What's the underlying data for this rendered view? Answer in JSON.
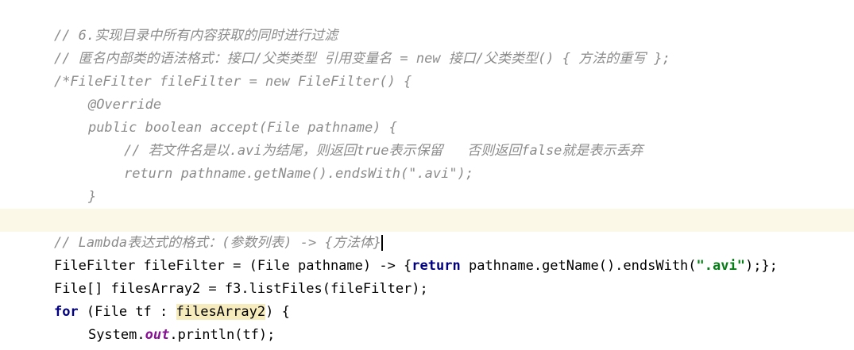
{
  "lines": [
    {
      "text": "// 6.实现目录中所有内容获取的同时进行过滤"
    },
    {
      "text": "// 匿名内部类的语法格式：接口/父类类型 引用变量名 = new 接口/父类类型() { 方法的重写 };"
    },
    {
      "text": "/*FileFilter fileFilter = new FileFilter() {"
    },
    {
      "text": "@Override"
    },
    {
      "text": "public boolean accept(File pathname) {"
    },
    {
      "text": "// 若文件名是以.avi为结尾，则返回true表示保留   否则返回false就是表示丢弃"
    },
    {
      "text": "return pathname.getName().endsWith(\".avi\");"
    },
    {
      "text": "}"
    },
    {
      "text": "};*/"
    },
    {
      "text": "// Lambda表达式的格式：(参数列表) -> {方法体}"
    },
    {
      "parts": [
        "FileFilter fileFilter = (File pathname) -> {",
        "return",
        " pathname.getName().endsWith(",
        "\".avi\"",
        ");};"
      ]
    },
    {
      "text": "File[] filesArray2 = f3.listFiles(fileFilter);"
    },
    {
      "parts": [
        "for",
        " (File tf : ",
        "filesArray2",
        ") {"
      ]
    },
    {
      "parts": [
        "System.",
        "out",
        ".println(tf);"
      ]
    },
    {
      "text": "}"
    }
  ]
}
